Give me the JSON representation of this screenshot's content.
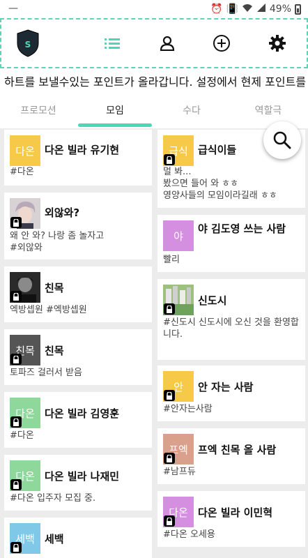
{
  "statusbar": {
    "notification": "—",
    "battery": "49%"
  },
  "toolbar": {
    "logo_letter": "S"
  },
  "ticker": {
    "text": "하트를 보낼수있는 포인트가 올라갑니다. 설정에서 현제 포인트를"
  },
  "tabs": [
    "프로모션",
    "모임",
    "수다",
    "역할극"
  ],
  "colors": {
    "accent": "#4fd6b6",
    "yellow": "#f7c948",
    "green": "#8ed89c",
    "lightblue": "#7fc8e8",
    "purple": "#d58fe0",
    "brown": "#d9a08c",
    "darkgray": "#555555"
  },
  "left_cards": [
    {
      "thumb_text": "다온",
      "title": "다온 빌라 유기현",
      "desc": "#다온"
    },
    {
      "thumb_text": "",
      "title": "외않와?",
      "desc": "왜 안 와? 나랑 좀 놀자고\n#외않와"
    },
    {
      "thumb_text": "",
      "title": "친목",
      "desc": "엑방셉원 #엑방셉원"
    },
    {
      "thumb_text": "친목",
      "title": "친목",
      "desc": "토파즈 걸러서 받음"
    },
    {
      "thumb_text": "다온",
      "title": "다온 빌라 김영훈",
      "desc": "#다온"
    },
    {
      "thumb_text": "다온",
      "title": "다온 빌라 나재민",
      "desc": "#다온 입주자 모집 중."
    },
    {
      "thumb_text": "세백",
      "title": "세백",
      "desc": ""
    }
  ],
  "right_cards": [
    {
      "thumb_text": "급식",
      "title": "급식이들",
      "desc": "멀 봐...\n봤으면 들어 와 ㅎㅎ\n영양사들의 모임이라길래 ㅎㅎ"
    },
    {
      "thumb_text": "야",
      "title": "야 김도영 쓰는 사람",
      "desc": "빨리"
    },
    {
      "thumb_text": "",
      "title": "신도시",
      "desc": "#신도시 신도시에 오신 것을 환영합니다."
    },
    {
      "thumb_text": "안",
      "title": "안 자는 사람",
      "desc": "#안자는사람"
    },
    {
      "thumb_text": "프엑",
      "title": "프엑 친목 올 사람",
      "desc": "#남프듀"
    },
    {
      "thumb_text": "다온",
      "title": "다온 빌라 이민혁",
      "desc": "#다온 오세용"
    }
  ]
}
